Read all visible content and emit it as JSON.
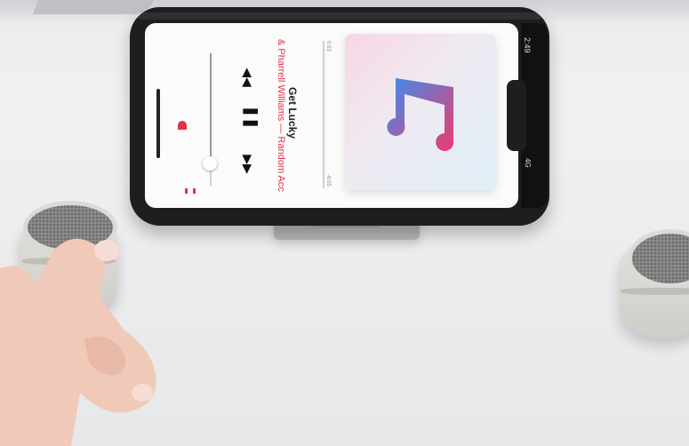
{
  "scene": {
    "description_free": true
  },
  "phone": {
    "status_time": "2:49",
    "status_signal": "4G"
  },
  "now_playing": {
    "song_title": "Get Lucky",
    "artist_line": "& Pharrell Williams — Random Acc",
    "time_elapsed": "0:03",
    "time_remaining": "-6:05",
    "progress_fraction": 0.01,
    "volume_fraction": 0.8,
    "volume_low_label": "",
    "volume_high_label": ""
  },
  "controls": {
    "prev_glyph": "◀◀",
    "pause_glyph": "❚❚",
    "next_glyph": "▶▶"
  },
  "colors": {
    "accent": "#e0334b",
    "phone_case": "#1d1e20",
    "speaker_body": "#d8d6d2"
  },
  "icons": {
    "album_art": "music-note-icon",
    "airplay": "airplay-icon",
    "lyrics": "lyrics-icon"
  }
}
